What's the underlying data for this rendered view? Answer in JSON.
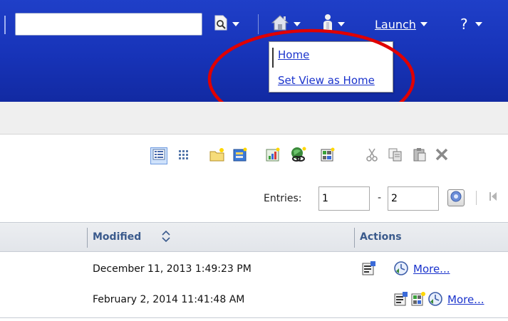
{
  "header": {
    "search": {
      "value": "",
      "placeholder": ""
    },
    "launch_label": "Launch",
    "help_label": "?"
  },
  "home_menu": {
    "items": [
      {
        "label": "Home"
      },
      {
        "label": "Set View as Home"
      }
    ]
  },
  "highlight": {
    "color": "#e00000"
  },
  "toolbar": {
    "buttons": [
      {
        "icon": "list-view-icon",
        "selected": true
      },
      {
        "icon": "thumbnail-view-icon"
      },
      {
        "icon": "new-folder-icon"
      },
      {
        "icon": "new-item-icon"
      },
      {
        "icon": "new-report-icon"
      },
      {
        "icon": "new-link-icon"
      },
      {
        "icon": "new-page-icon"
      },
      {
        "icon": "cut-icon"
      },
      {
        "icon": "copy-icon"
      },
      {
        "icon": "paste-icon"
      },
      {
        "icon": "delete-icon"
      }
    ]
  },
  "pager": {
    "entries_label": "Entries:",
    "from": "1",
    "separator": "-",
    "to": "2"
  },
  "table": {
    "columns": [
      {
        "label": "Modified"
      },
      {
        "label": "Actions"
      }
    ],
    "rows": [
      {
        "modified": "December 11, 2013 1:49:23 PM",
        "actions": [
          "set-properties-icon",
          "schedule-icon"
        ],
        "more": "More..."
      },
      {
        "modified": "February 2, 2014 11:41:48 AM",
        "actions": [
          "set-properties-icon",
          "add-to-page-icon",
          "schedule-icon"
        ],
        "more": "More..."
      }
    ]
  },
  "colors": {
    "banner": "#1733b8",
    "link": "#1a33cc",
    "column_header_text": "#3a5a8c"
  }
}
